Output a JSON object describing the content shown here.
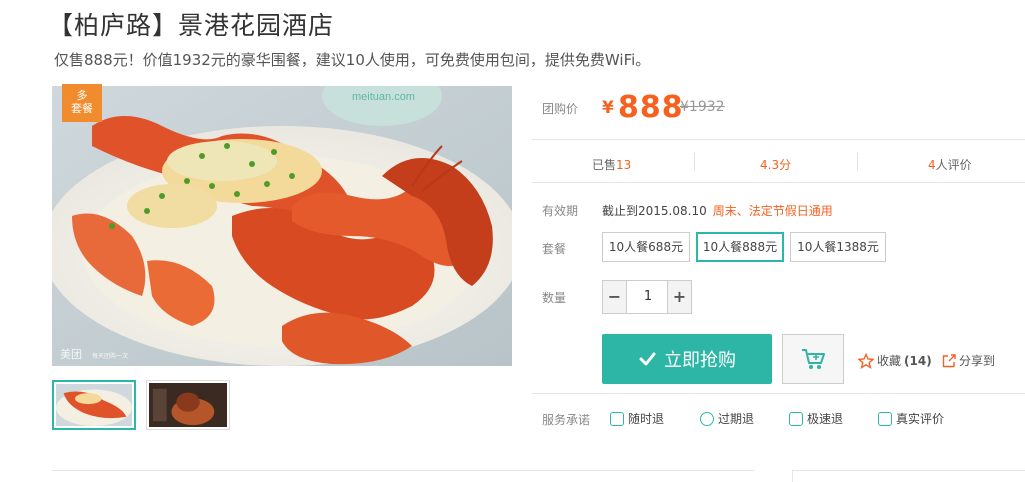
{
  "deal": {
    "title": "【柏庐路】景港花园酒店",
    "subtitle": "仅售888元！价值1932元的豪华围餐，建议10人使用，可免费使用包间，提供免费WiFi。",
    "tag": "多\n套餐",
    "price_label": "团购价",
    "currency": "¥",
    "price": "888",
    "original_price": "¥1932"
  },
  "stats": {
    "sold_label": "已售",
    "sold_count": "13",
    "rating": "4.3",
    "rating_unit": "分",
    "reviews_count": "4",
    "reviews_label": "人评价"
  },
  "validity": {
    "label": "有效期",
    "value": "截止到2015.08.10",
    "note": "周末、法定节假日通用"
  },
  "packages": {
    "label": "套餐",
    "options": [
      "10人餐688元",
      "10人餐888元",
      "10人餐1388元"
    ],
    "selected_index": 1
  },
  "quantity": {
    "label": "数量",
    "minus": "−",
    "plus": "+",
    "value": "1"
  },
  "actions": {
    "buy_label": "立即抢购",
    "favorite_label": "收藏",
    "favorite_count": "(14)",
    "share_label": "分享到"
  },
  "service": {
    "label": "服务承诺",
    "items": [
      "随时退",
      "过期退",
      "极速退",
      "真实评价"
    ]
  },
  "image": {
    "watermark": "美团",
    "watermark_small": "每天团购一次",
    "logo_text": "meituan.com"
  },
  "colors": {
    "accent": "#2db5a5",
    "price": "#f76120",
    "tag": "#f08c2e"
  }
}
